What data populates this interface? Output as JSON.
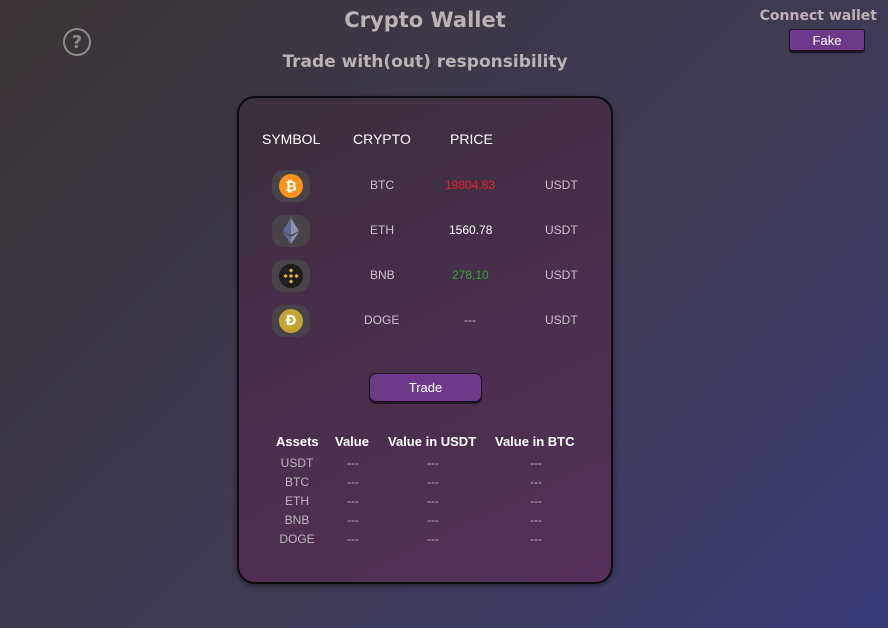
{
  "header": {
    "help_icon": "?",
    "title": "Crypto Wallet",
    "subtitle": "Trade with(out) responsibility",
    "connect_label": "Connect wallet",
    "connect_button": "Fake"
  },
  "prices": {
    "columns": [
      "SYMBOL",
      "CRYPTO",
      "PRICE"
    ],
    "rows": [
      {
        "icon": "bitcoin-icon",
        "symbol": "BTC",
        "price": "19804.83",
        "price_color": "#e0202a",
        "quote": "USDT"
      },
      {
        "icon": "ethereum-icon",
        "symbol": "ETH",
        "price": "1560.78",
        "price_color": "#ffffff",
        "quote": "USDT"
      },
      {
        "icon": "bnb-icon",
        "symbol": "BNB",
        "price": "278.10",
        "price_color": "#2fa52f",
        "quote": "USDT"
      },
      {
        "icon": "dogecoin-icon",
        "symbol": "DOGE",
        "price": "---",
        "price_color": "#c9c3c8",
        "quote": "USDT"
      }
    ]
  },
  "trade_button": "Trade",
  "assets": {
    "columns": [
      "Assets",
      "Value",
      "Value in USDT",
      "Value in BTC"
    ],
    "rows": [
      {
        "asset": "USDT",
        "value": "---",
        "usdt": "---",
        "btc": "---"
      },
      {
        "asset": "BTC",
        "value": "---",
        "usdt": "---",
        "btc": "---"
      },
      {
        "asset": "ETH",
        "value": "---",
        "usdt": "---",
        "btc": "---"
      },
      {
        "asset": "BNB",
        "value": "---",
        "usdt": "---",
        "btc": "---"
      },
      {
        "asset": "DOGE",
        "value": "---",
        "usdt": "---",
        "btc": "---"
      }
    ]
  },
  "colors": {
    "accent": "#6d3a8a",
    "card_bg": "#4a2f4c"
  }
}
